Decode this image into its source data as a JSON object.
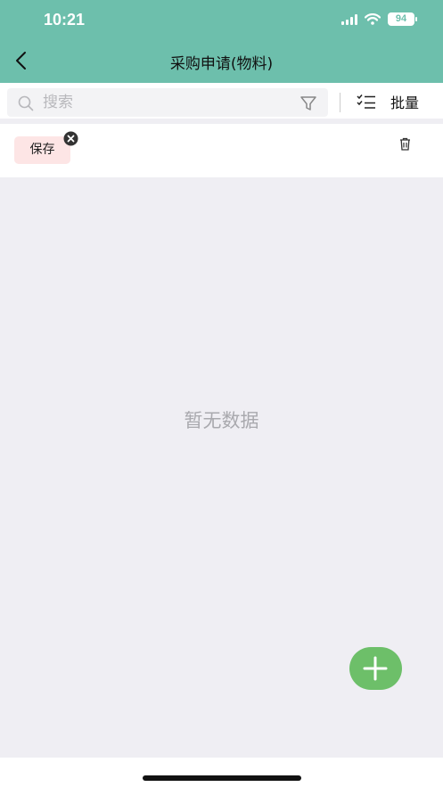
{
  "status_bar": {
    "time": "10:21",
    "battery": "94"
  },
  "nav": {
    "title": "采购申请(物料)"
  },
  "search": {
    "placeholder": "搜索",
    "batch_label": "批量"
  },
  "tags": [
    {
      "label": "保存"
    }
  ],
  "empty_state": {
    "text": "暂无数据"
  },
  "icons": [
    "back-arrow-icon",
    "search-icon",
    "filter-icon",
    "checklist-icon",
    "close-icon",
    "trash-icon",
    "plus-icon"
  ],
  "colors": {
    "header": "#6dbfac",
    "fab": "#6dbf69",
    "tag_bg": "#fde5e5",
    "page_bg": "#efeef3"
  }
}
